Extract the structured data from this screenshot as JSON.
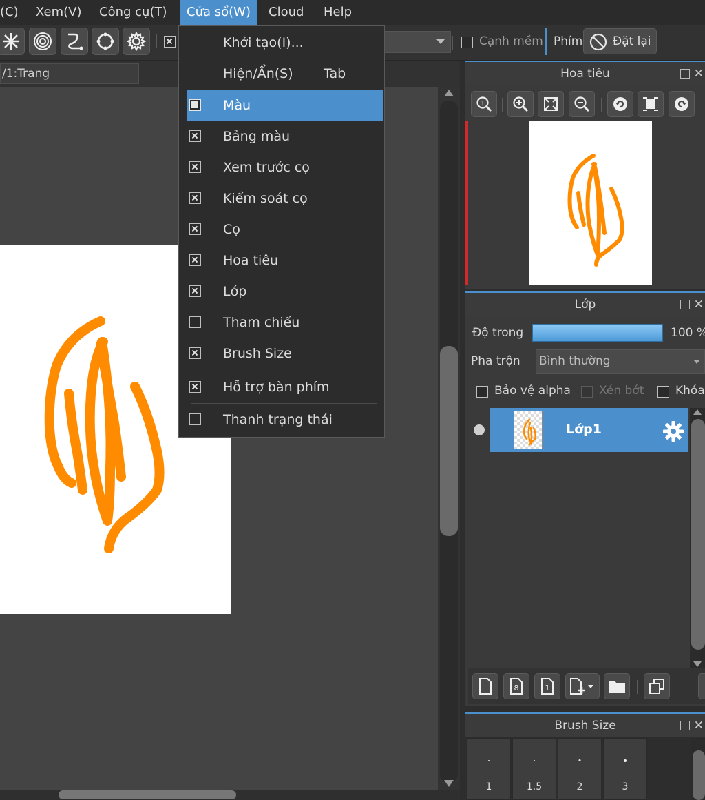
{
  "menubar": {
    "items": [
      {
        "label": "(C)"
      },
      {
        "label": "Xem(V)"
      },
      {
        "label": "Công cụ(T)"
      },
      {
        "label": "Cửa sổ(W)"
      },
      {
        "label": "Cloud"
      },
      {
        "label": "Help"
      }
    ],
    "active_index": 3
  },
  "toolbar": {
    "soft_edge_label": "Cạnh mềm",
    "keys_label": "Phím",
    "reset_label": "Đặt lại"
  },
  "canvas": {
    "tab_label": "/1:Trang"
  },
  "window_menu": {
    "items": [
      {
        "label": "Khởi tạo(I)...",
        "check": "none"
      },
      {
        "label": "Hiện/Ẩn(S)",
        "shortcut": "Tab",
        "check": "none"
      },
      {
        "label": "Màu",
        "check": "filled",
        "highlighted": true
      },
      {
        "label": "Bảng màu",
        "check": "x"
      },
      {
        "label": "Xem trước cọ",
        "check": "x"
      },
      {
        "label": "Kiểm soát cọ",
        "check": "x"
      },
      {
        "label": "Cọ",
        "check": "x"
      },
      {
        "label": "Hoa tiêu",
        "check": "x"
      },
      {
        "label": "Lớp",
        "check": "x"
      },
      {
        "label": "Tham chiếu",
        "check": "empty"
      },
      {
        "label": "Brush Size",
        "check": "x"
      },
      {
        "label": "Hỗ trợ bàn phím",
        "check": "x"
      },
      {
        "label": "Thanh trạng thái",
        "check": "empty"
      }
    ]
  },
  "navigator": {
    "title": "Hoa tiêu"
  },
  "layer_panel": {
    "title": "Lớp",
    "opacity_label": "Độ trong",
    "opacity_value": "100 %",
    "opacity_fraction": 1.0,
    "blend_label": "Pha trộn",
    "blend_value": "Bình thường",
    "protect_alpha": "Bảo vệ alpha",
    "clipping": "Xén bớt",
    "lock": "Khóa",
    "layer_name": "Lớp1"
  },
  "brush_size": {
    "title": "Brush Size",
    "sizes": [
      "1",
      "1.5",
      "2",
      "3"
    ]
  },
  "colors": {
    "accent": "#4b8fcc",
    "stroke": "#ff8c00"
  }
}
